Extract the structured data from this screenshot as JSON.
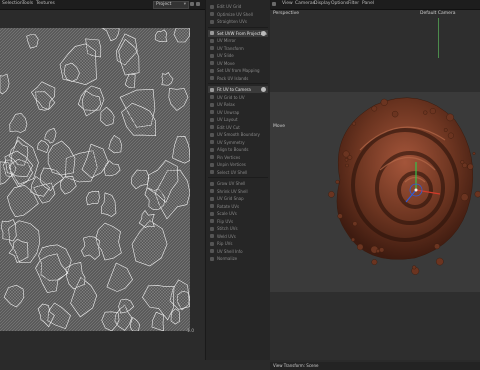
{
  "topbar": {
    "menus": [
      "Selection",
      "Tools",
      "Textures"
    ],
    "dropdown_value": "Project",
    "viewport_menus": [
      "View",
      "Cameras",
      "Display",
      "Options",
      "Filter",
      "Panel"
    ]
  },
  "uv_panel": {
    "corner_label": "1.0"
  },
  "tools": [
    "Edit UV Grid",
    "Optimize UV Shell",
    "Straighten UVs",
    "Set UVW From Projection",
    "UV Mirror",
    "UV Transform",
    "UV Slide",
    "UV Move",
    "Set UV from Mapping",
    "Pack UV Islands",
    "Fit UV to Camera",
    "UV Grid to UV",
    "UV Relax",
    "UV Unwrap",
    "UV Layout",
    "Edit UV Cut",
    "UV Smooth Boundary",
    "UV Symmetry",
    "Align to Bounds",
    "Pin Vertices",
    "Unpin Vertices",
    "Select UV Shell",
    "Grow UV Shell",
    "Shrink UV Shell",
    "UV Grid Snap",
    "Rotate UVs",
    "Scale UVs",
    "Flip UVs",
    "Stitch UVs",
    "Weld UVs",
    "Rip UVs",
    "UV Shell Info",
    "Normalize"
  ],
  "viewport": {
    "perspective_label": "Perspective",
    "camera_label": "Default Camera",
    "move_label": "Move",
    "status_text": "View Transform: Scene"
  },
  "colors": {
    "uv_background": "#5a5a5a",
    "uv_lines": "#f2f2f2",
    "chocolate": "#6b3420",
    "axis_x": "#d23a2a",
    "axis_y": "#34c24a",
    "axis_z": "#2f5bd8"
  },
  "icons": [
    "gear-icon",
    "camera-icon"
  ]
}
